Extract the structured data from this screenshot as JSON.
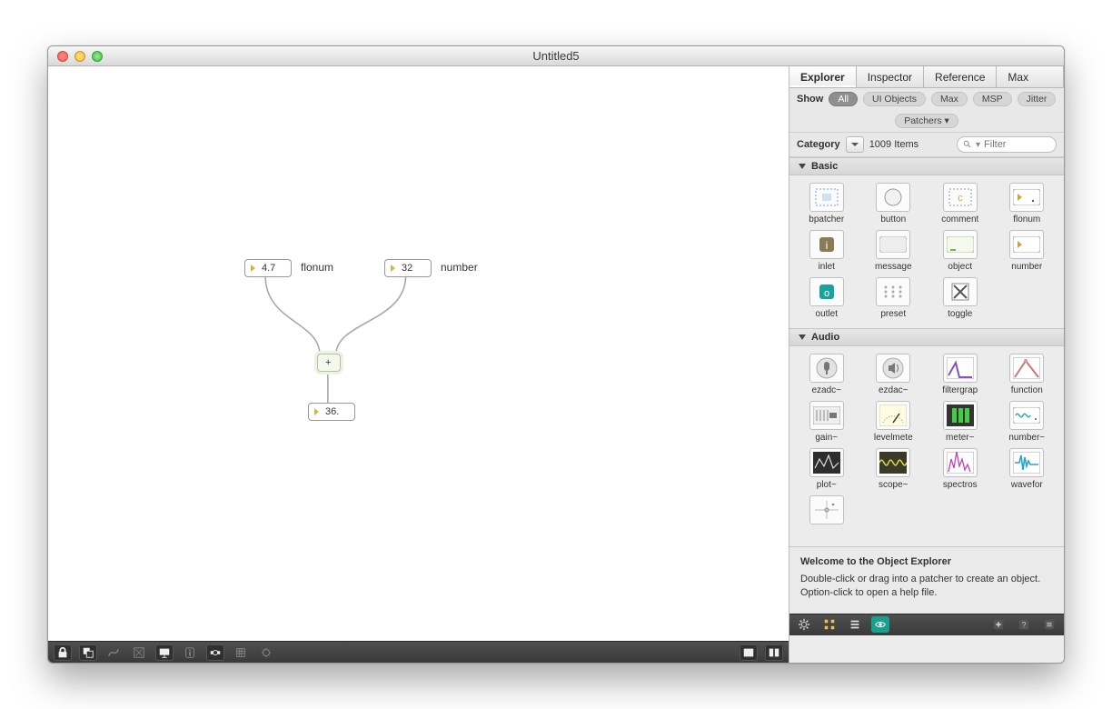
{
  "window": {
    "title": "Untitled5"
  },
  "patcher": {
    "flonum_value": "4.7",
    "flonum_label": "flonum",
    "number_value": "32",
    "number_label": "number",
    "op_label": "+",
    "result_value": "36."
  },
  "sidebar": {
    "tabs": {
      "explorer": "Explorer",
      "inspector": "Inspector",
      "reference": "Reference",
      "max": "Max"
    },
    "show_label": "Show",
    "filters": {
      "all": "All",
      "ui": "UI Objects",
      "max": "Max",
      "msp": "MSP",
      "jitter": "Jitter",
      "patchers": "Patchers ▾"
    },
    "category_label": "Category",
    "item_count": "1009 Items",
    "filter_placeholder": "Filter",
    "sections": {
      "basic": {
        "title": "Basic",
        "items": [
          "bpatcher",
          "button",
          "comment",
          "flonum",
          "inlet",
          "message",
          "object",
          "number",
          "outlet",
          "preset",
          "toggle"
        ]
      },
      "audio": {
        "title": "Audio",
        "items": [
          "ezadc~",
          "ezdac~",
          "filtergrap",
          "function",
          "gain~",
          "levelmete",
          "meter~",
          "number~",
          "plot~",
          "scope~",
          "spectros",
          "wavefor"
        ]
      }
    },
    "help": {
      "title": "Welcome to the Object Explorer",
      "line1": "Double-click or drag into a patcher to create an object.",
      "line2": "Option-click to open a help file."
    }
  }
}
